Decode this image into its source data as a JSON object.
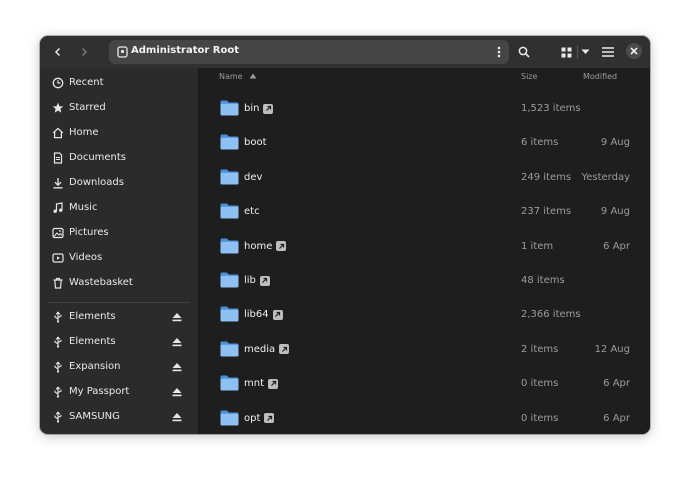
{
  "header": {
    "location": "Administrator Root",
    "back_icon": "chevron-left-icon",
    "forward_icon": "chevron-right-icon",
    "search_icon": "search-icon",
    "view_icon": "grid-view-icon",
    "menu_icon": "hamburger-menu-icon",
    "close_icon": "close-icon"
  },
  "sidebar": {
    "places": [
      {
        "label": "Recent",
        "icon": "clock-icon"
      },
      {
        "label": "Starred",
        "icon": "star-icon"
      },
      {
        "label": "Home",
        "icon": "home-icon"
      },
      {
        "label": "Documents",
        "icon": "document-icon"
      },
      {
        "label": "Downloads",
        "icon": "download-icon"
      },
      {
        "label": "Music",
        "icon": "music-icon"
      },
      {
        "label": "Pictures",
        "icon": "picture-icon"
      },
      {
        "label": "Videos",
        "icon": "video-icon"
      },
      {
        "label": "Wastebasket",
        "icon": "trash-icon"
      }
    ],
    "devices": [
      {
        "label": "Elements",
        "icon": "usb-icon"
      },
      {
        "label": "Elements",
        "icon": "usb-icon"
      },
      {
        "label": "Expansion",
        "icon": "usb-icon"
      },
      {
        "label": "My Passport",
        "icon": "usb-icon"
      },
      {
        "label": "SAMSUNG",
        "icon": "usb-icon"
      }
    ]
  },
  "columns": {
    "name": "Name",
    "size": "Size",
    "modified": "Modified"
  },
  "files": [
    {
      "name": "bin",
      "size": "1,523 items",
      "modified": "",
      "symlink": true
    },
    {
      "name": "boot",
      "size": "6 items",
      "modified": "9 Aug",
      "symlink": false
    },
    {
      "name": "dev",
      "size": "249 items",
      "modified": "Yesterday",
      "symlink": false
    },
    {
      "name": "etc",
      "size": "237 items",
      "modified": "9 Aug",
      "symlink": false
    },
    {
      "name": "home",
      "size": "1 item",
      "modified": "6 Apr",
      "symlink": true
    },
    {
      "name": "lib",
      "size": "48 items",
      "modified": "",
      "symlink": true
    },
    {
      "name": "lib64",
      "size": "2,366 items",
      "modified": "",
      "symlink": true
    },
    {
      "name": "media",
      "size": "2 items",
      "modified": "12 Aug",
      "symlink": true
    },
    {
      "name": "mnt",
      "size": "0 items",
      "modified": "6 Apr",
      "symlink": true
    },
    {
      "name": "opt",
      "size": "0 items",
      "modified": "6 Apr",
      "symlink": true
    }
  ],
  "colors": {
    "folder": "#8fc0f3",
    "folder_tab": "#4a90d9",
    "background": "#1e1e1e",
    "sidebar": "#2b2b2b"
  }
}
